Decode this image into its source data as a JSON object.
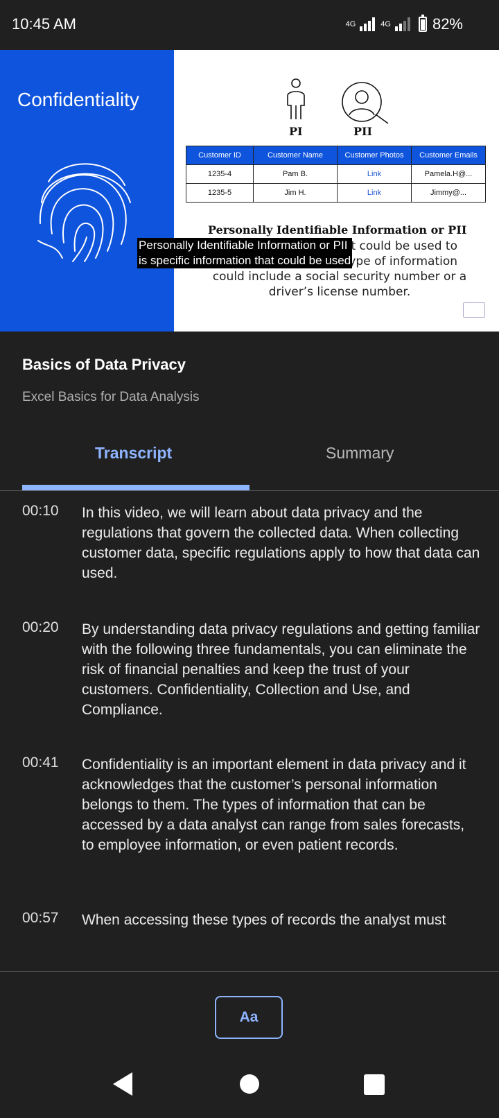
{
  "status_bar": {
    "time": "10:45 AM",
    "network1": "4G",
    "network2": "4G",
    "battery_level": 0.82,
    "battery_text": "82%"
  },
  "video": {
    "slide_title": "Confidentiality",
    "pi_label": "PI",
    "pii_label": "PII",
    "table": {
      "headers": [
        "Customer ID",
        "Customer Name",
        "Customer Photos",
        "Customer Emails"
      ],
      "rows": [
        [
          "1235-4",
          "Pam B.",
          "Link",
          "Pamela.H@..."
        ],
        [
          "1235-5",
          "Jim H.",
          "Link",
          "Jimmy@..."
        ]
      ]
    },
    "pii_heading": "Personally Identifiable Information or PII",
    "pii_body_lines": [
      "t could be used to",
      "ype of information",
      "could include a social security number or a",
      "driver’s license number."
    ],
    "caption_lines": [
      "Personally Identifiable Information or PII",
      "is specific information that could be used"
    ]
  },
  "course": {
    "title": "Basics of Data Privacy",
    "subtitle": "Excel Basics for Data Analysis"
  },
  "tabs": {
    "transcript": "Transcript",
    "summary": "Summary",
    "active": "transcript"
  },
  "transcript": [
    {
      "time": "00:10",
      "text": "In this video, we will learn about data privacy and the regulations that govern the collected data.  When collecting customer data, specific regulations apply to how that data can used."
    },
    {
      "time": "00:20",
      "text": "By understanding data privacy regulations and getting familiar with the following three fundamentals, you can eliminate the risk of financial penalties and keep the trust of your customers.  Confidentiality, Collection and Use, and Compliance."
    },
    {
      "time": "00:41",
      "text": "Confidentiality is an important element in data privacy and it acknowledges that the customer’s personal information belongs to them.  The types of information that can be accessed by a data analyst can range from sales forecasts, to employee information, or even patient records."
    },
    {
      "time": "00:57",
      "text": "When accessing these types of records the analyst must"
    }
  ],
  "font_button": "Aa",
  "colors": {
    "accent": "#8fb4ff",
    "slide_blue": "#0f54dc",
    "background": "#202020"
  }
}
